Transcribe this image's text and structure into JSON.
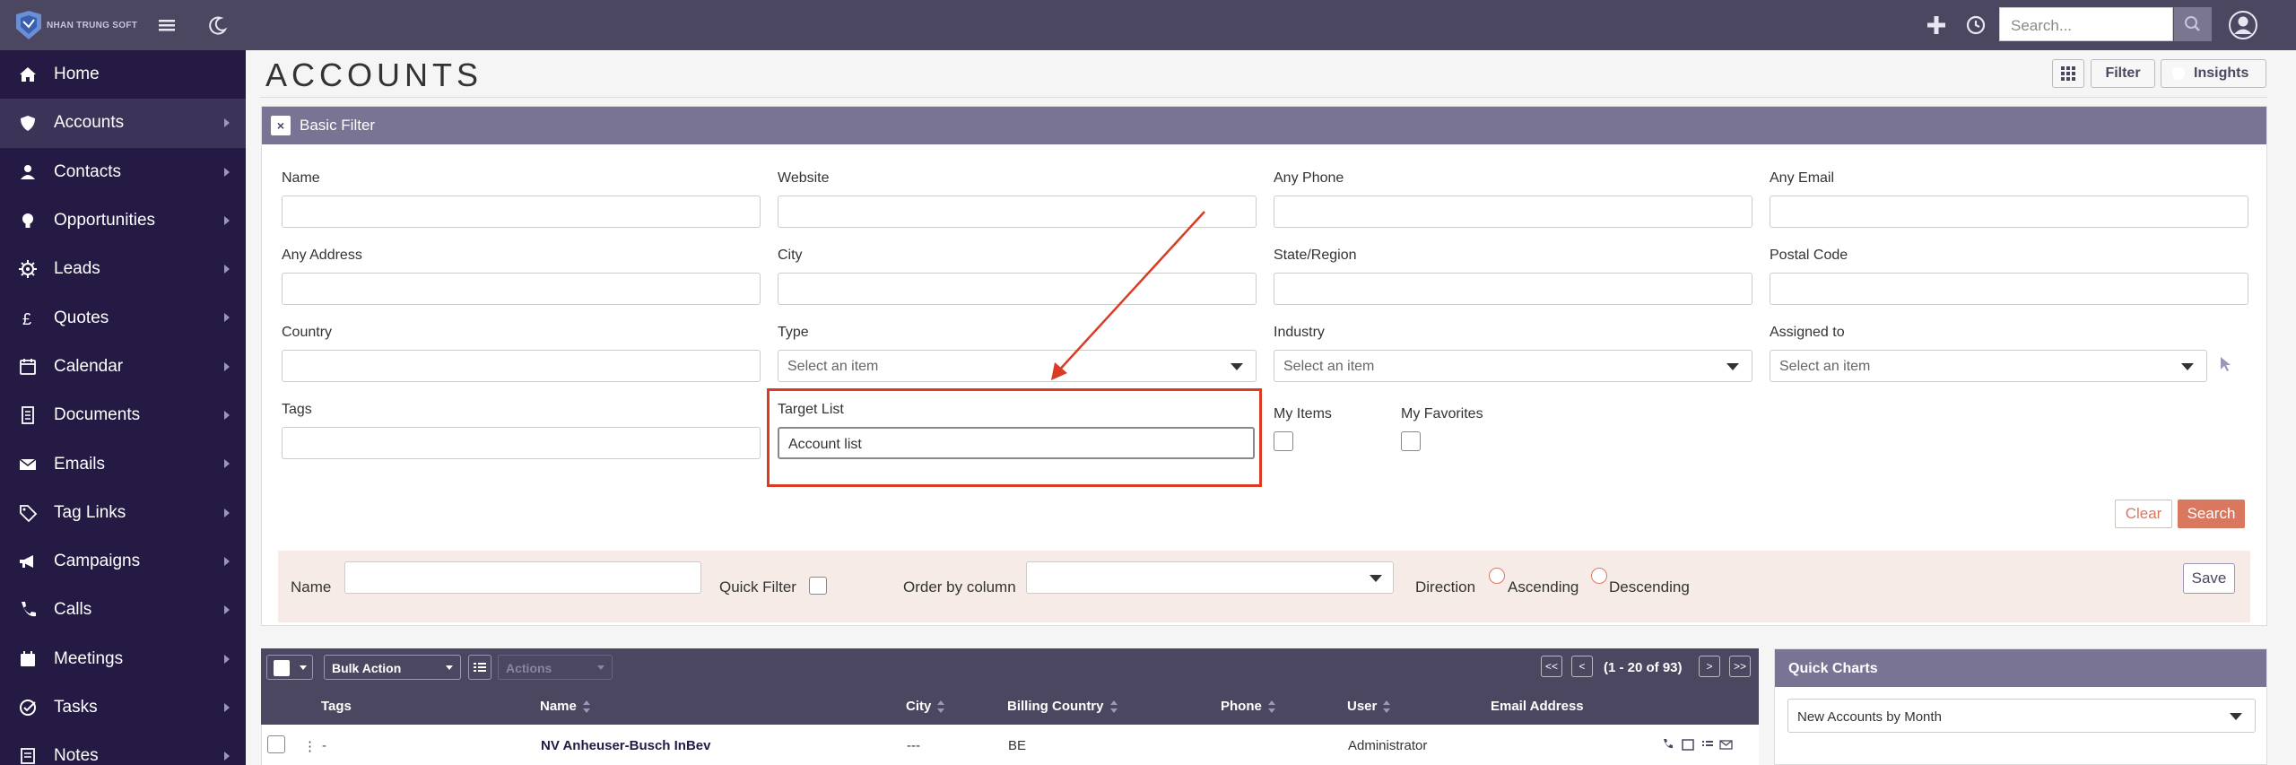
{
  "brand": {
    "name": "NHAN TRUNG SOFT"
  },
  "topbar": {
    "search_placeholder": "Search..."
  },
  "sidebar": {
    "items": [
      {
        "label": "Home",
        "icon": "home-icon"
      },
      {
        "label": "Accounts",
        "icon": "shield-icon"
      },
      {
        "label": "Contacts",
        "icon": "person-icon"
      },
      {
        "label": "Opportunities",
        "icon": "lightbulb-icon"
      },
      {
        "label": "Leads",
        "icon": "gear-icon"
      },
      {
        "label": "Quotes",
        "icon": "pound-icon"
      },
      {
        "label": "Calendar",
        "icon": "calendar-icon"
      },
      {
        "label": "Documents",
        "icon": "document-icon"
      },
      {
        "label": "Emails",
        "icon": "envelope-icon"
      },
      {
        "label": "Tag Links",
        "icon": "tag-icon"
      },
      {
        "label": "Campaigns",
        "icon": "megaphone-icon"
      },
      {
        "label": "Calls",
        "icon": "phone-icon"
      },
      {
        "label": "Meetings",
        "icon": "meeting-icon"
      },
      {
        "label": "Tasks",
        "icon": "check-circle-icon"
      },
      {
        "label": "Notes",
        "icon": "notes-icon"
      }
    ]
  },
  "header": {
    "title": "ACCOUNTS",
    "filter_label": "Filter",
    "insights_label": "Insights"
  },
  "filter": {
    "title": "Basic Filter",
    "close": "×",
    "fields": {
      "name": {
        "label": "Name",
        "value": ""
      },
      "website": {
        "label": "Website",
        "value": ""
      },
      "any_phone": {
        "label": "Any Phone",
        "value": ""
      },
      "any_email": {
        "label": "Any Email",
        "value": ""
      },
      "any_address": {
        "label": "Any Address",
        "value": ""
      },
      "city": {
        "label": "City",
        "value": ""
      },
      "state": {
        "label": "State/Region",
        "value": ""
      },
      "postal": {
        "label": "Postal Code",
        "value": ""
      },
      "country": {
        "label": "Country",
        "value": ""
      },
      "type": {
        "label": "Type",
        "placeholder": "Select an item"
      },
      "industry": {
        "label": "Industry",
        "placeholder": "Select an item"
      },
      "assigned": {
        "label": "Assigned to",
        "placeholder": "Select an item"
      },
      "tags": {
        "label": "Tags",
        "value": ""
      },
      "target_list": {
        "label": "Target List",
        "value": "Account list"
      },
      "my_items": {
        "label": "My Items"
      },
      "my_favorites": {
        "label": "My Favorites"
      }
    },
    "clear_label": "Clear",
    "search_label": "Search",
    "saved": {
      "name_label": "Name",
      "quick_filter_label": "Quick Filter",
      "order_label": "Order by column",
      "direction_label": "Direction",
      "ascending": "Ascending",
      "descending": "Descending",
      "save_label": "Save"
    }
  },
  "list": {
    "bulk_action": "Bulk Action",
    "actions": "Actions",
    "pagination": {
      "first": "<<",
      "prev": "<",
      "range": "(1 - 20 of 93)",
      "next": ">",
      "last": ">>"
    },
    "columns": [
      "Tags",
      "Name",
      "City",
      "Billing Country",
      "Phone",
      "User",
      "Email Address"
    ],
    "rows": [
      {
        "tags": "-",
        "name": "NV Anheuser-Busch InBev",
        "city": "---",
        "country": "BE",
        "phone": "",
        "user": "Administrator",
        "email": ""
      }
    ]
  },
  "quick_charts": {
    "title": "Quick Charts",
    "selected": "New Accounts by Month"
  },
  "colors": {
    "accent": "#4b4760",
    "sidebar": "#241a44",
    "search": "#d9775f",
    "highlight": "#d93b25"
  }
}
